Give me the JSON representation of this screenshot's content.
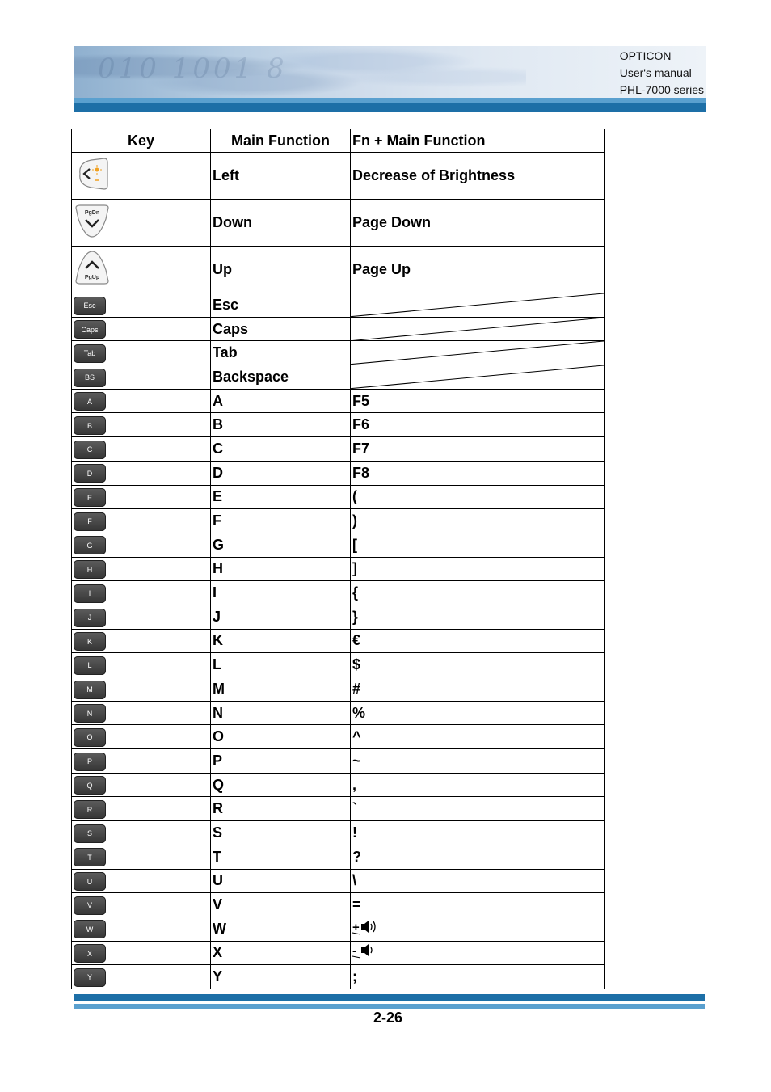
{
  "header": {
    "lines": [
      "OPTICON",
      "User's manual",
      "PHL-7000 series"
    ],
    "banner_digits": "010 1001 8"
  },
  "table": {
    "columns": [
      "Key",
      "Main Function",
      "Fn + Main Function"
    ],
    "rows": [
      {
        "key_icon": "left-brightness-key",
        "key_label": "",
        "main": "Left",
        "fn": "Decrease of Brightness"
      },
      {
        "key_icon": "pgdn-down-key",
        "key_label": "PgDn",
        "main": "Down",
        "fn": "Page Down"
      },
      {
        "key_icon": "pgup-up-key",
        "key_label": "PgUp",
        "main": "Up",
        "fn": "Page Up"
      },
      {
        "key_icon": "esc-key",
        "key_label": "Esc",
        "main": "Esc",
        "fn": ""
      },
      {
        "key_icon": "caps-key",
        "key_label": "Caps",
        "main": "Caps",
        "fn": ""
      },
      {
        "key_icon": "tab-key",
        "key_label": "Tab",
        "main": "Tab",
        "fn": ""
      },
      {
        "key_icon": "bs-key",
        "key_label": "BS",
        "main": "Backspace",
        "fn": ""
      },
      {
        "key_icon": "a-key",
        "key_label": "A",
        "main": "A",
        "fn": "F5"
      },
      {
        "key_icon": "b-key",
        "key_label": "B",
        "main": "B",
        "fn": "F6"
      },
      {
        "key_icon": "c-key",
        "key_label": "C",
        "main": "C",
        "fn": "F7"
      },
      {
        "key_icon": "d-key",
        "key_label": "D",
        "main": "D",
        "fn": "F8"
      },
      {
        "key_icon": "e-key",
        "key_label": "E",
        "main": "E",
        "fn": "("
      },
      {
        "key_icon": "f-key",
        "key_label": "F",
        "main": "F",
        "fn": ")"
      },
      {
        "key_icon": "g-key",
        "key_label": "G",
        "main": "G",
        "fn": "["
      },
      {
        "key_icon": "h-key",
        "key_label": "H",
        "main": "H",
        "fn": "]"
      },
      {
        "key_icon": "i-key",
        "key_label": "I",
        "main": "I",
        "fn": "{"
      },
      {
        "key_icon": "j-key",
        "key_label": "J",
        "main": "J",
        "fn": "}"
      },
      {
        "key_icon": "k-key",
        "key_label": "K",
        "main": "K",
        "fn": "€"
      },
      {
        "key_icon": "l-key",
        "key_label": "L",
        "main": "L",
        "fn": "$"
      },
      {
        "key_icon": "m-key",
        "key_label": "M",
        "main": "M",
        "fn": "#"
      },
      {
        "key_icon": "n-key",
        "key_label": "N",
        "main": "N",
        "fn": "%"
      },
      {
        "key_icon": "o-key",
        "key_label": "O",
        "main": "O",
        "fn": "^"
      },
      {
        "key_icon": "p-key",
        "key_label": "P",
        "main": "P",
        "fn": "~"
      },
      {
        "key_icon": "q-key",
        "key_label": "Q",
        "main": "Q",
        "fn": ","
      },
      {
        "key_icon": "r-key",
        "key_label": "R",
        "main": "R",
        "fn": " `"
      },
      {
        "key_icon": "s-key",
        "key_label": "S",
        "main": "S",
        "fn": "!"
      },
      {
        "key_icon": "t-key",
        "key_label": "T",
        "main": "T",
        "fn": "?"
      },
      {
        "key_icon": "u-key",
        "key_label": "U",
        "main": "U",
        "fn": "\\"
      },
      {
        "key_icon": "v-key",
        "key_label": "V",
        "main": "V",
        "fn": "="
      },
      {
        "key_icon": "w-key",
        "key_label": "W",
        "main": "W",
        "fn": "+",
        "fn_icon": "volume-up-icon"
      },
      {
        "key_icon": "x-key",
        "key_label": "X",
        "main": "X",
        "fn": "-",
        "fn_icon": "volume-down-icon"
      },
      {
        "key_icon": "y-key",
        "key_label": "Y",
        "main": "Y",
        "fn": ";"
      }
    ]
  },
  "footer": {
    "page_number": "2-26"
  },
  "colors": {
    "fn_text": "#1a1aff",
    "stripe_dark": "#1d6fa7",
    "stripe_light": "#5aa0cf"
  }
}
